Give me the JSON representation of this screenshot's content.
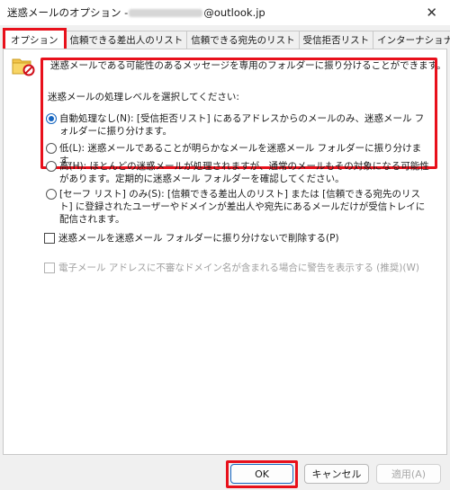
{
  "window": {
    "title_prefix": "迷惑メールのオプション - ",
    "title_suffix": "@outlook.jp",
    "close_glyph": "✕"
  },
  "tabs": [
    {
      "label": "オプション",
      "active": true
    },
    {
      "label": "信頼できる差出人のリスト",
      "active": false
    },
    {
      "label": "信頼できる宛先のリスト",
      "active": false
    },
    {
      "label": "受信拒否リスト",
      "active": false
    },
    {
      "label": "インターナショナル",
      "active": false
    }
  ],
  "options": {
    "icon": "junk-mail-folder-icon",
    "intro": "迷惑メールである可能性のあるメッセージを専用のフォルダーに振り分けることができます。",
    "level_label": "迷惑メールの処理レベルを選択してください:",
    "levels": [
      {
        "label": "自動処理なし(N): [受信拒否リスト] にあるアドレスからのメールのみ、迷惑メール フォルダーに振り分けます。",
        "checked": true
      },
      {
        "label": "低(L): 迷惑メールであることが明らかなメールを迷惑メール フォルダーに振り分けます。",
        "checked": false
      },
      {
        "label": "高(H): ほとんどの迷惑メールが処理されますが、通常のメールもその対象になる可能性があります。定期的に迷惑メール フォルダーを確認してください。",
        "checked": false
      },
      {
        "label": "[セーフ リスト] のみ(S): [信頼できる差出人のリスト] または [信頼できる宛先のリスト] に登録されたユーザーやドメインが差出人や宛先にあるメールだけが受信トレイに配信されます。",
        "checked": false
      }
    ],
    "delete_checkbox": "迷惑メールを迷惑メール フォルダーに振り分けないで削除する(P)",
    "warn_checkbox": "電子メール アドレスに不審なドメイン名が含まれる場合に警告を表示する (推奨)(W)"
  },
  "buttons": {
    "ok": "OK",
    "cancel": "キャンセル",
    "apply": "適用(A)"
  },
  "colors": {
    "highlight": "#e8101b",
    "accent": "#1565c0"
  }
}
